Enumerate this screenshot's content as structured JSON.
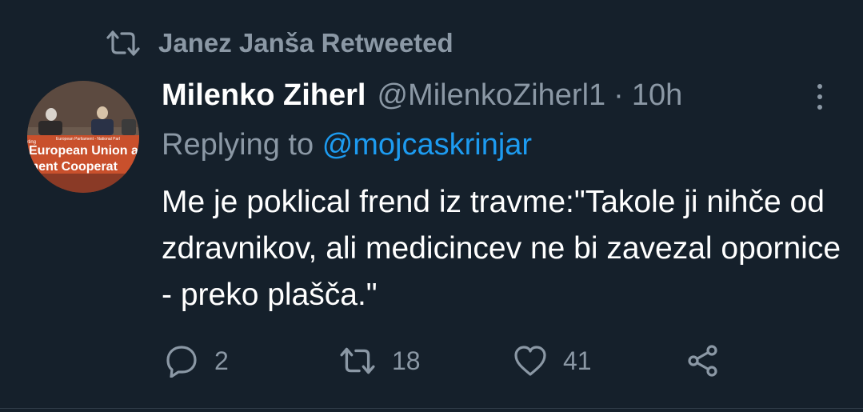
{
  "retweet": {
    "label": "Janez Janša Retweeted"
  },
  "tweet": {
    "display_name": "Milenko Ziherl",
    "handle": "@MilenkoZiherl1",
    "separator": "·",
    "time": "10h",
    "replying_prefix": "Replying to",
    "replying_handle": "@mojcaskrinjar",
    "text": "Me je poklical frend iz travme:\"Takole ji nihče od zdravnikov, ali medicincev ne bi zavezal opornice - preko plašča.\"",
    "avatar_banner": {
      "line1": "European Union a",
      "line2": "ment Cooperat",
      "header": "European Parliament - National Parl",
      "left_tag": "eting"
    }
  },
  "actions": {
    "reply_count": "2",
    "retweet_count": "18",
    "like_count": "41"
  },
  "icons": {
    "retweet": "retweet-icon",
    "reply": "reply-icon",
    "like": "heart-icon",
    "share": "share-icon",
    "more": "more-icon"
  },
  "colors": {
    "background": "#15202b",
    "muted": "#8b98a5",
    "link": "#1d9bf0",
    "text": "#ffffff"
  }
}
